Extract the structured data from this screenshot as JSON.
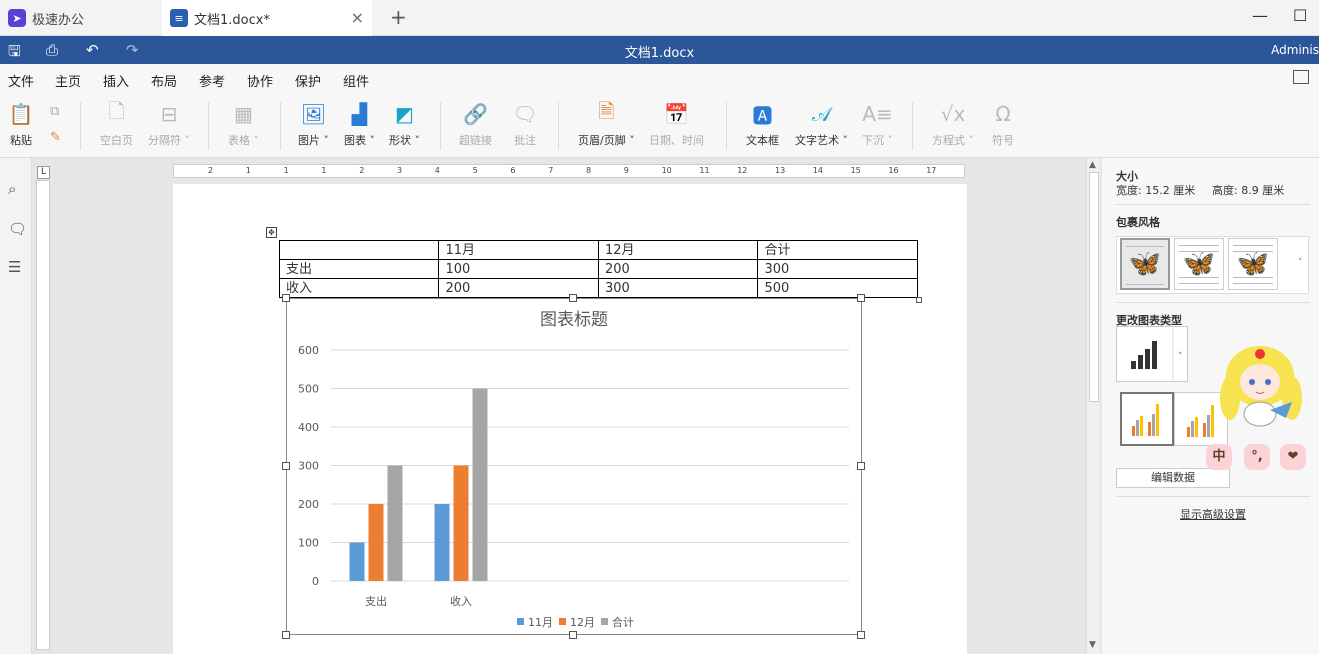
{
  "tabs": {
    "app_tab": "极速办公",
    "doc_tab": "文档1.docx*",
    "close": "×",
    "new_tab": "+"
  },
  "titlebar": {
    "title": "文档1.docx",
    "user": "Adminis"
  },
  "menu": [
    "文件",
    "主页",
    "插入",
    "布局",
    "参考",
    "协作",
    "保护",
    "组件"
  ],
  "menu_active": "插入",
  "ribbon": {
    "paste": "粘贴",
    "blank_page": "空白页",
    "page_break": "分隔符",
    "table": "表格",
    "image": "图片",
    "chart": "图表",
    "shape": "形状",
    "hyperlink": "超链接",
    "comment": "批注",
    "header_footer": "页眉/页脚",
    "datetime": "日期、时间",
    "textbox": "文本框",
    "wordart": "文字艺术",
    "dropcap": "下沉",
    "equation": "方程式",
    "symbol": "符号"
  },
  "ruler_numbers": [
    "2",
    "1",
    "1",
    "1",
    "2",
    "3",
    "4",
    "5",
    "6",
    "7",
    "8",
    "9",
    "10",
    "11",
    "12",
    "13",
    "14",
    "15",
    "16",
    "17"
  ],
  "corner_label": "L",
  "table": {
    "header": [
      "",
      "11月",
      "12月",
      "合计"
    ],
    "rows": [
      [
        "支出",
        "100",
        "200",
        "300"
      ],
      [
        "收入",
        "200",
        "300",
        "500"
      ]
    ]
  },
  "chart_data": {
    "type": "bar",
    "title": "图表标题",
    "categories": [
      "支出",
      "收入"
    ],
    "series": [
      {
        "name": "11月",
        "values": [
          100,
          200
        ],
        "color": "#5b9bd5"
      },
      {
        "name": "12月",
        "values": [
          200,
          300
        ],
        "color": "#ed7d31"
      },
      {
        "name": "合计",
        "values": [
          300,
          500
        ],
        "color": "#a5a5a5"
      }
    ],
    "yticks": [
      0,
      100,
      200,
      300,
      400,
      500,
      600
    ],
    "ylim": [
      0,
      600
    ],
    "grid": true,
    "legend": "bottom"
  },
  "panel": {
    "size_title": "大小",
    "width": "宽度: 15.2 厘米",
    "height": "高度: 8.9 厘米",
    "wrap_title": "包裹风格",
    "change_type": "更改图表类型",
    "edit_data": "编辑数据",
    "advanced": "显示高级设置"
  },
  "ime": [
    "中",
    "°,",
    "❤"
  ],
  "colors": {
    "titlebar": "#2b579a",
    "accent": "#2b579a"
  }
}
